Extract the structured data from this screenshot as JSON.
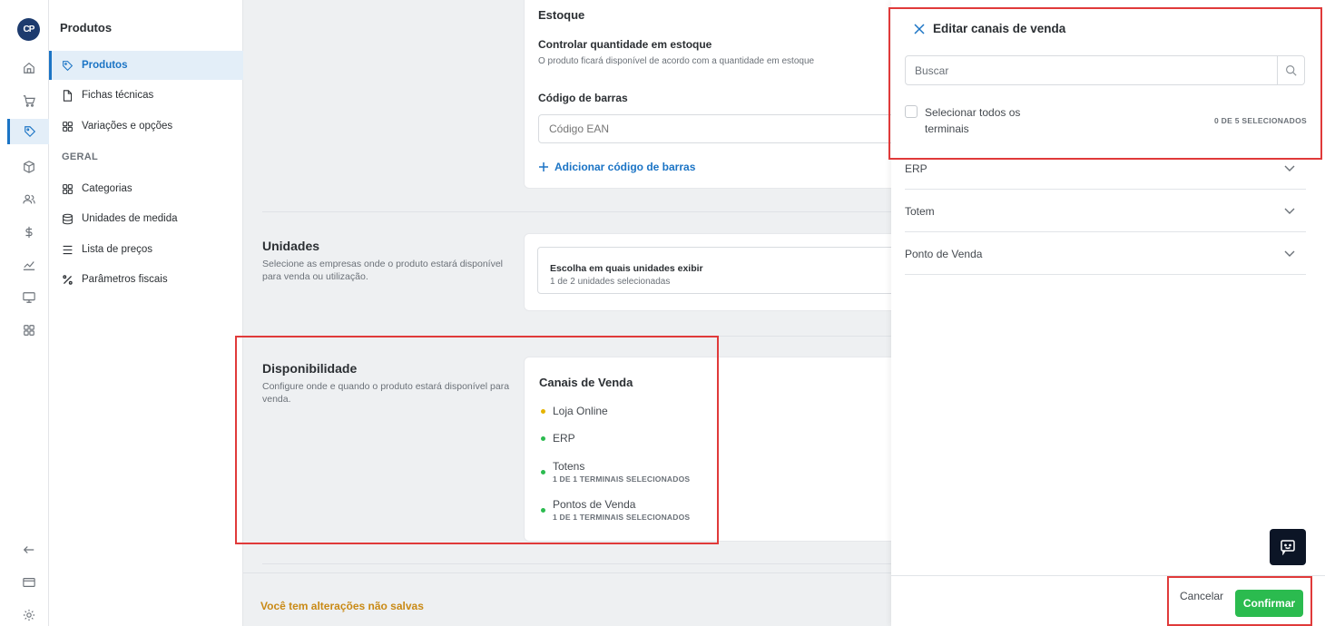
{
  "rail": {
    "logo": "CP",
    "icons": [
      "home-icon",
      "cart-icon",
      "tag-icon",
      "box-icon",
      "users-icon",
      "dollar-icon",
      "chart-icon",
      "monitor-icon",
      "grid-icon"
    ],
    "bottom_icons": [
      "arrow-left-icon",
      "card-icon",
      "gear-icon"
    ]
  },
  "subnav": {
    "title": "Produtos",
    "items": [
      {
        "label": "Produtos",
        "icon": "tag-icon"
      },
      {
        "label": "Fichas técnicas",
        "icon": "file-icon"
      },
      {
        "label": "Variações e opções",
        "icon": "grid-icon"
      }
    ],
    "section_label": "GERAL",
    "general_items": [
      {
        "label": "Categorias",
        "icon": "grid-icon"
      },
      {
        "label": "Unidades de medida",
        "icon": "database-icon"
      },
      {
        "label": "Lista de preços",
        "icon": "list-icon"
      },
      {
        "label": "Parâmetros fiscais",
        "icon": "percent-icon"
      }
    ]
  },
  "main": {
    "estoque": {
      "title": "Estoque",
      "control_title": "Controlar quantidade em estoque",
      "control_desc": "O produto ficará disponível de acordo com a quantidade em estoque",
      "barcode_label": "Código de barras",
      "barcode_placeholder": "Código EAN",
      "add_barcode": "Adicionar código de barras"
    },
    "unidades": {
      "title": "Unidades",
      "desc": "Selecione as empresas onde o produto estará disponível para venda ou utilização.",
      "box_title": "Escolha em quais unidades exibir",
      "box_sub": "1 de 2 unidades selecionadas"
    },
    "disponibilidade": {
      "title": "Disponibilidade",
      "desc": "Configure onde e quando o produto estará disponível para venda.",
      "card_title": "Canais de Venda",
      "channels": [
        {
          "name": "Loja Online",
          "sub": "",
          "color": "#e5b400"
        },
        {
          "name": "ERP",
          "sub": "",
          "color": "#2bbb4f"
        },
        {
          "name": "Totens",
          "sub": "1 DE 1 TERMINAIS SELECIONADOS",
          "color": "#2bbb4f"
        },
        {
          "name": "Pontos de Venda",
          "sub": "1 DE 1 TERMINAIS SELECIONADOS",
          "color": "#2bbb4f"
        }
      ]
    },
    "unsaved": "Você tem alterações não salvas"
  },
  "drawer": {
    "title": "Editar canais de venda",
    "search_placeholder": "Buscar",
    "select_all": "Selecionar todos os terminais",
    "selected_count": "0 DE 5 SELECIONADOS",
    "groups": [
      "ERP",
      "Totem",
      "Ponto de Venda"
    ],
    "cancel": "Cancelar",
    "confirm": "Confirmar"
  },
  "colors": {
    "accent": "#1b74c5",
    "confirm": "#2bbb4f",
    "warning": "#c98a16",
    "annotation": "#e03a3a"
  }
}
